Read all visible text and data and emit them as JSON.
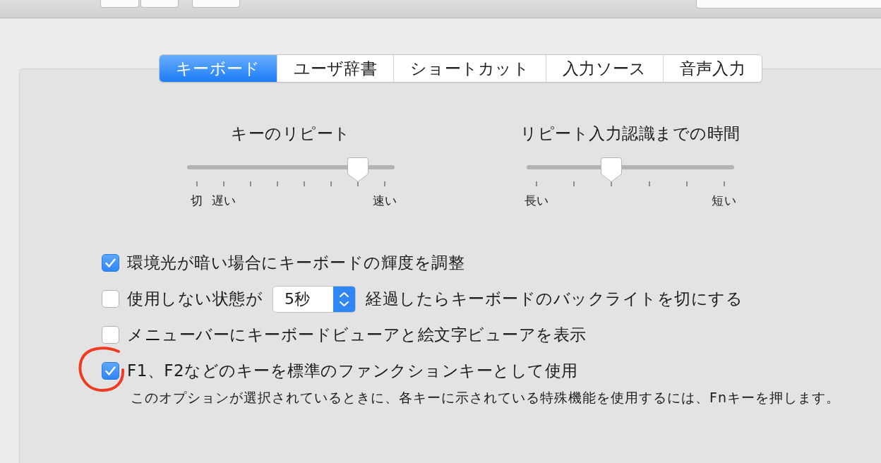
{
  "tabs": [
    {
      "label": "キーボード",
      "selected": true
    },
    {
      "label": "ユーザ辞書",
      "selected": false
    },
    {
      "label": "ショートカット",
      "selected": false
    },
    {
      "label": "入力ソース",
      "selected": false
    },
    {
      "label": "音声入力",
      "selected": false
    }
  ],
  "sliders": [
    {
      "title": "キーのリピート",
      "level": 0.857,
      "ticks": [
        {
          "kind": "labeled",
          "label": "切"
        },
        {
          "kind": "labeled",
          "label": "遅い"
        },
        {
          "kind": "plain"
        },
        {
          "kind": "plain"
        },
        {
          "kind": "plain"
        },
        {
          "kind": "plain"
        },
        {
          "kind": "plain"
        },
        {
          "kind": "labeled",
          "label": "速い"
        }
      ]
    },
    {
      "title": "リピート入力認識までの時間",
      "level": 0.4,
      "ticks": [
        {
          "kind": "labeled",
          "label": "長い"
        },
        {
          "kind": "plain"
        },
        {
          "kind": "plain"
        },
        {
          "kind": "plain"
        },
        {
          "kind": "plain"
        },
        {
          "kind": "labeled",
          "label": "短い"
        }
      ]
    }
  ],
  "options": [
    {
      "kind": "checkbox",
      "label": "環境光が暗い場合にキーボードの輝度を調整",
      "checked": true,
      "circled": false
    },
    {
      "kind": "checkbox-popup",
      "label": "使用しない状態が",
      "popup_value": "5秒",
      "label_after": "経過したらキーボードのバックライトを切にする",
      "checked": false,
      "circled": false
    },
    {
      "kind": "checkbox",
      "label": "メニューバーにキーボードビューアと絵文字ビューアを表示",
      "checked": false,
      "circled": false
    },
    {
      "kind": "checkbox",
      "label": "F1、F2などのキーを標準のファンクションキーとして使用",
      "checked": true,
      "circled": true,
      "note": "このオプションが選択されているときに、各キーに示されている特殊機能を使用するには、Fnキーを押します。"
    }
  ]
}
